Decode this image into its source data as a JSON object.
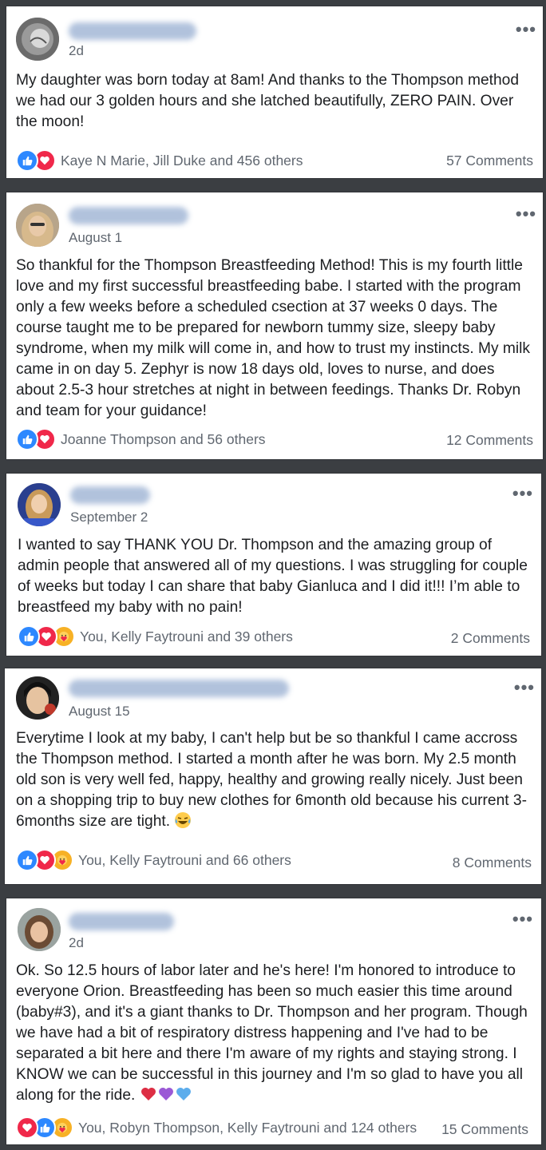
{
  "colors": {
    "background": "#3b3e42",
    "card": "#ffffff",
    "like": "#2d88ff",
    "love": "#f0284a",
    "care": "#f7b125",
    "secondary_text": "#606770"
  },
  "posts": [
    {
      "author": "",
      "date": "2d",
      "more": "•••",
      "text": "My daughter was born today at 8am! And thanks to the Thompson method we had our 3 golden hours and she latched beautifully, ZERO PAIN. Over the moon!",
      "reactions": [
        "like",
        "love"
      ],
      "reaction_summary": "Kaye N Marie, Jill Duke and 456 others",
      "comments": "57 Comments"
    },
    {
      "author": "",
      "date": "August 1",
      "more": "•••",
      "text": "So thankful for the Thompson Breastfeeding Method! This is my fourth little love and my first successful breastfeeding babe. I started with the program only a few weeks before a scheduled csection at 37 weeks 0 days. The course taught me to be prepared for newborn tummy size, sleepy baby syndrome, when my milk will come in, and how to trust my instincts. My milk came in on day 5. Zephyr is now 18 days old, loves to nurse, and does about 2.5-3 hour stretches at night in between feedings. Thanks Dr. Robyn and team for your guidance!",
      "reactions": [
        "like",
        "love"
      ],
      "reaction_summary": "Joanne Thompson and 56 others",
      "comments": "12 Comments"
    },
    {
      "author": "",
      "date": "September 2",
      "more": "•••",
      "text": "I wanted to say THANK YOU Dr. Thompson and the amazing group of admin people that answered all of my questions. I was struggling for couple of weeks but today I can share that baby Gianluca and I did it!!! I’m able to breastfeed my baby with no pain!",
      "reactions": [
        "like",
        "love",
        "care"
      ],
      "reaction_summary": "You, Kelly Faytrouni and 39 others",
      "comments": "2 Comments"
    },
    {
      "author": "",
      "date": "August 15",
      "more": "•••",
      "text": "Everytime I look at my baby, I can't help but be so thankful I came accross the Thompson method. I started a month after he was born. My 2.5 month old son is very well fed, happy, healthy and growing really nicely. Just been on a shopping trip to buy new clothes for 6month old because his current 3-6months size are tight.",
      "text_emoji": "laughing-tears-emoji",
      "reactions": [
        "like",
        "love",
        "care"
      ],
      "reaction_summary": "You, Kelly Faytrouni and 66 others",
      "comments": "8 Comments"
    },
    {
      "author": "",
      "date": "2d",
      "more": "•••",
      "text": "Ok. So 12.5 hours of labor later and he's here! I'm honored to introduce to everyone Orion. Breastfeeding has been so much easier this time around (baby#3), and it's a giant thanks to Dr. Thompson and her program. Though we have had a bit of respiratory distress happening and I've had to be separated a bit here and there I'm aware of my rights and staying strong. I KNOW we can be successful in this journey and I'm so glad to have you all along for the ride.",
      "text_emoji": "red-purple-blue-hearts-emoji",
      "reactions": [
        "love",
        "like",
        "care"
      ],
      "reaction_summary": "You, Robyn Thompson, Kelly Faytrouni and 124 others",
      "comments": "15 Comments"
    }
  ]
}
